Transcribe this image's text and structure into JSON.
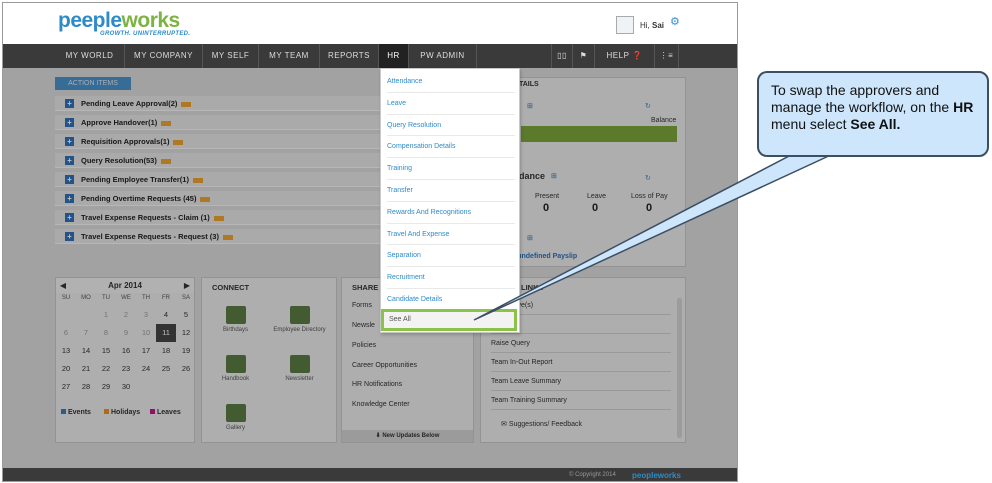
{
  "header": {
    "logo_prefix": "peeple",
    "logo_suffix": "works",
    "tagline": "GROWTH. UNINTERRUPTED.",
    "greeting_prefix": "Hi,",
    "user_name": "Sai"
  },
  "nav": {
    "items": [
      "MY WORLD",
      "MY COMPANY",
      "MY SELF",
      "MY TEAM",
      "REPORTS",
      "HR",
      "PW ADMIN"
    ],
    "help_label": "HELP"
  },
  "action_items": {
    "tab_label": "ACTION ITEMS",
    "rows": [
      "Pending Leave Approval(2)",
      "Approve Handover(1)",
      "Requisition Approvals(1)",
      "Query Resolution(53)",
      "Pending Employee Transfer(1)",
      "Pending Overtime Requests (45)",
      "Travel Expense Requests - Claim (1)",
      "Travel Expense Requests - Request (3)"
    ]
  },
  "details": {
    "title_suffix": "TAILS",
    "balance_label": "Balance",
    "attendance_title": "dance",
    "present_label": "Present",
    "leave_label": "Leave",
    "lop_label": "Loss of Pay",
    "present_value": "0",
    "leave_value": "0",
    "lop_value": "0",
    "payslip_text": "d undefined Payslip"
  },
  "calendar": {
    "month": "Apr 2014",
    "dow": [
      "SU",
      "MO",
      "TU",
      "WE",
      "TH",
      "FR",
      "SA"
    ],
    "rows": [
      [
        "",
        "",
        "1",
        "2",
        "3",
        "4",
        "5"
      ],
      [
        "6",
        "7",
        "8",
        "9",
        "10",
        "11",
        "12"
      ],
      [
        "13",
        "14",
        "15",
        "16",
        "17",
        "18",
        "19"
      ],
      [
        "20",
        "21",
        "22",
        "23",
        "24",
        "25",
        "26"
      ],
      [
        "27",
        "28",
        "29",
        "30",
        "",
        "",
        ""
      ]
    ],
    "today": "11",
    "legend": [
      "Events",
      "Holidays",
      "Leaves"
    ],
    "legend_colors": [
      "#2f7fc4",
      "#e89020",
      "#c2178a"
    ]
  },
  "connect": {
    "title": "CONNECT",
    "tiles": [
      "Birthdays",
      "Employee Directory",
      "Handbook",
      "Newsletter",
      "Gallery"
    ]
  },
  "share": {
    "title": "SHARE",
    "items": [
      "Forms",
      "Newsle",
      "Policies",
      "Career Opportunities",
      "HR Notifications",
      "Knowledge Center"
    ],
    "footer": "New Updates Below"
  },
  "links": {
    "title": "LINKS",
    "items": [
      "ncel Leave(s)",
      "neral Info",
      "Raise Query",
      "Team In-Out Report",
      "Team Leave Summary",
      "Team Training Summary"
    ],
    "feedback": "Suggestions/ Feedback"
  },
  "hr_menu": {
    "items": [
      "Attendance",
      "Leave",
      "Query Resolution",
      "Compensation Details",
      "Training",
      "Transfer",
      "Rewards And Recognitions",
      "Travel And Expense",
      "Separation",
      "Recruitment",
      "Candidate Details"
    ],
    "see_all": "See All"
  },
  "footer": {
    "copyright": "© Copyright 2014",
    "brand": "peopleworks"
  },
  "callout": {
    "line1": "To swap the approvers and manage the workflow, on the",
    "menu_name": "HR",
    "line2": "menu select",
    "target": "See All."
  },
  "colors": {
    "accent": "#2f8bc7",
    "highlight": "#8bc34a",
    "nav_bg": "#3a3a3a"
  }
}
